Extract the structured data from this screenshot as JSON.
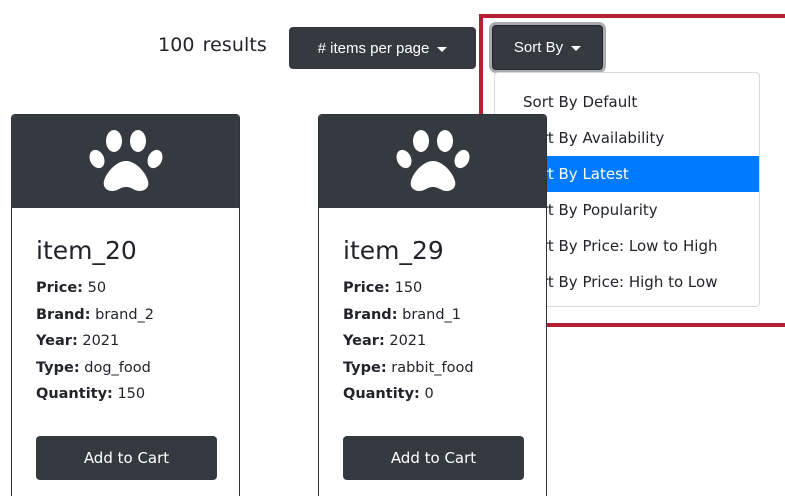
{
  "toolbar": {
    "results_count": "100",
    "results_label": "results",
    "items_per_page_label": "# items per page",
    "sort_label": "Sort By"
  },
  "sort_menu": {
    "items": [
      {
        "label": "Sort By Default"
      },
      {
        "label": "Sort By Availability"
      },
      {
        "label": "Sort By Latest",
        "active": true
      },
      {
        "label": "Sort By Popularity"
      },
      {
        "label": "Sort By Price: Low to High"
      },
      {
        "label": "Sort By Price: High to Low"
      }
    ]
  },
  "products": [
    {
      "name": "item_20",
      "icon": "paw-icon",
      "price_label": "Price:",
      "price": "50",
      "brand_label": "Brand:",
      "brand": "brand_2",
      "year_label": "Year:",
      "year": "2021",
      "type_label": "Type:",
      "type": "dog_food",
      "quantity_label": "Quantity:",
      "quantity": "150",
      "button_label": "Add to Cart"
    },
    {
      "name": "item_29",
      "icon": "paw-icon",
      "price_label": "Price:",
      "price": "150",
      "brand_label": "Brand:",
      "brand": "brand_1",
      "year_label": "Year:",
      "year": "2021",
      "type_label": "Type:",
      "type": "rabbit_food",
      "quantity_label": "Quantity:",
      "quantity": "0",
      "button_label": "Add to Cart"
    }
  ],
  "colors": {
    "dark": "#343a40",
    "active": "#007bff",
    "highlight": "#b22234"
  }
}
